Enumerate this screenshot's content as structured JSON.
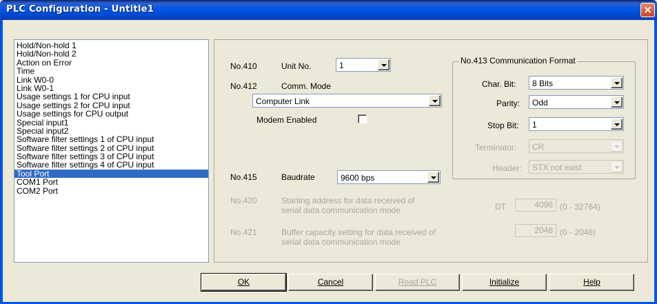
{
  "window": {
    "title": "PLC Configuration - Untitle1",
    "close_label": "×"
  },
  "sidebar": {
    "items": [
      "Hold/Non-hold 1",
      "Hold/Non-hold 2",
      "Action on Error",
      "Time",
      "Link W0-0",
      "Link W0-1",
      "Usage settings 1 for CPU input",
      "Usage settings 2 for CPU input",
      "Usage settings for CPU output",
      "Special input1",
      "Special input2",
      "Software filter settings 1 of CPU input",
      "Software filter settings 2 of CPU input",
      "Software filter settings 3 of CPU input",
      "Software filter settings 4 of CPU input",
      "Tool Port",
      "COM1 Port",
      "COM2 Port"
    ],
    "selected": "Tool Port"
  },
  "settings": {
    "unit_no_code": "No.410",
    "unit_no_label": "Unit No.",
    "unit_no_value": "1",
    "comm_mode_code": "No.412",
    "comm_mode_label": "Comm. Mode",
    "comm_mode_value": "Computer Link",
    "modem_label": "Modem Enabled",
    "modem_checked": false,
    "baud_code": "No.415",
    "baud_label": "Baudrate",
    "baud_value": "9600 bps",
    "start_addr_code": "No.420",
    "start_addr_line1": "Starting address for data received of",
    "start_addr_line2": "serial data communication mode",
    "start_addr_prefix": "DT",
    "start_addr_value": "4096",
    "start_addr_range": "(0 - 32764)",
    "buffer_code": "No.421",
    "buffer_line1": "Buffer capacity setting for data received of",
    "buffer_line2": "serial data communication mode",
    "buffer_value": "2048",
    "buffer_range": "(0 - 2048)"
  },
  "comm_format": {
    "title": "No.413 Communication Format",
    "char_bit_label": "Char. Bit:",
    "char_bit_value": "8 Bits",
    "parity_label": "Parity:",
    "parity_value": "Odd",
    "stop_bit_label": "Stop Bit:",
    "stop_bit_value": "1",
    "terminator_label": "Terminator:",
    "terminator_value": "CR",
    "header_label": "Header:",
    "header_value": "STX not exist."
  },
  "buttons": {
    "ok_label": "OK",
    "cancel_label": "Cancel",
    "read_plc_label": "Read PLC",
    "initialize_label": "Initialize",
    "help_label": "Help"
  }
}
